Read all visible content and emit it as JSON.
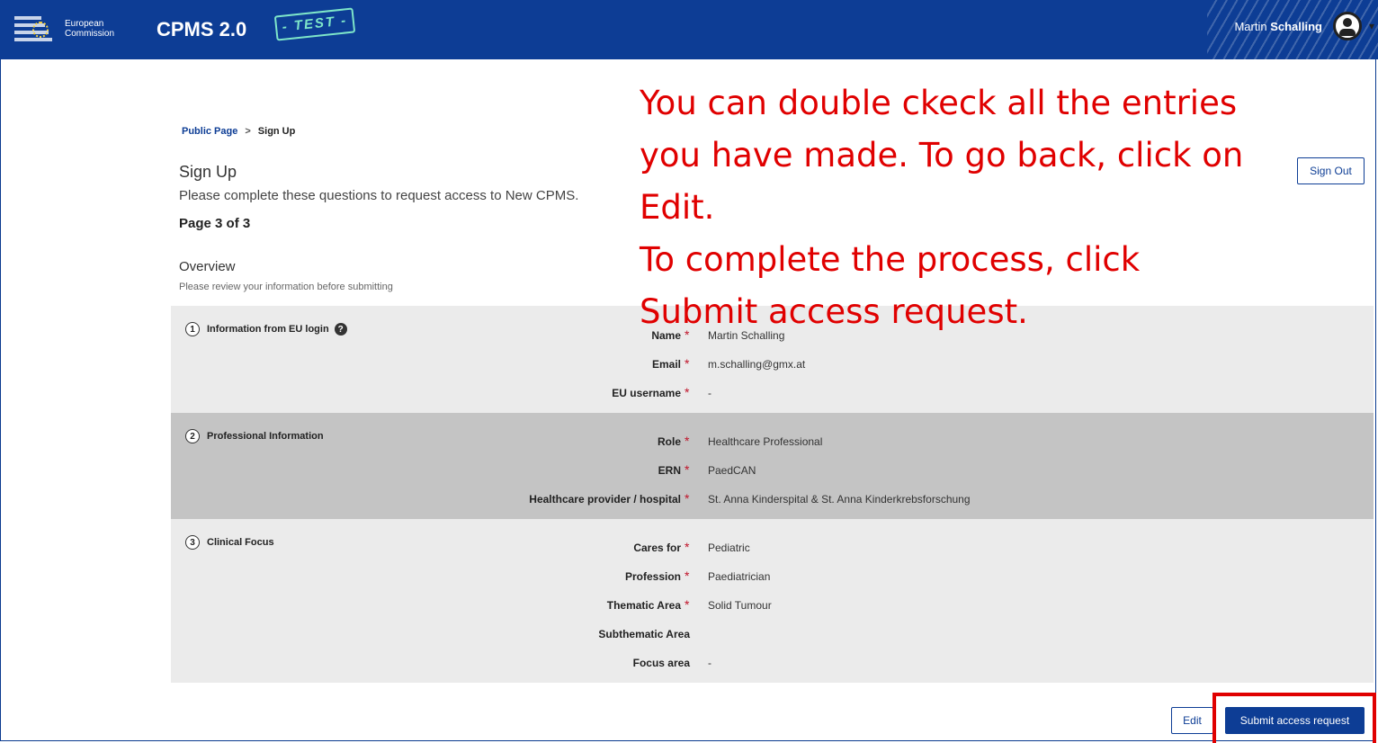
{
  "header": {
    "org_line1": "European",
    "org_line2": "Commission",
    "app_title": "CPMS 2.0",
    "env_badge": "- TEST -",
    "user_first": "Martin",
    "user_last": "Schalling"
  },
  "breadcrumb": {
    "home": "Public Page",
    "separator": ">",
    "current": "Sign Up"
  },
  "page": {
    "title": "Sign Up",
    "intro": "Please complete these questions to request access to New CPMS.",
    "page_count": "Page 3 of 3",
    "overview_title": "Overview",
    "overview_sub": "Please review your information before submitting"
  },
  "buttons": {
    "sign_out": "Sign Out",
    "edit": "Edit",
    "submit": "Submit access request"
  },
  "sections": [
    {
      "num": "1",
      "title": "Information from EU login",
      "fields": [
        {
          "label": "Name",
          "value": "Martin Schalling"
        },
        {
          "label": "Email",
          "value": "m.schalling@gmx.at"
        },
        {
          "label": "EU username",
          "value": "-"
        }
      ]
    },
    {
      "num": "2",
      "title": "Professional Information",
      "fields": [
        {
          "label": "Role",
          "value": "Healthcare Professional"
        },
        {
          "label": "ERN",
          "value": "PaedCAN"
        },
        {
          "label": "Healthcare provider / hospital",
          "value": "St. Anna Kinderspital & St. Anna Kinderkrebsforschung"
        }
      ]
    },
    {
      "num": "3",
      "title": "Clinical Focus",
      "fields": [
        {
          "label": "Cares for",
          "value": "Pediatric"
        },
        {
          "label": "Profession",
          "value": "Paediatrician"
        },
        {
          "label": "Thematic Area",
          "value": "Solid Tumour"
        },
        {
          "label": "Subthematic Area",
          "value": ""
        },
        {
          "label": "Focus area",
          "value": "-"
        }
      ]
    }
  ],
  "required_mark": "*",
  "help_glyph": "?",
  "annotation": {
    "line1": "You can double ckeck all the entries",
    "line2": "you have made. To go back, click on",
    "line3": "Edit.",
    "line4": "To complete the process, click",
    "line5": "Submit access request."
  },
  "colors": {
    "brand": "#0d3d95",
    "annotation": "#e00000",
    "required": "#c0142a"
  }
}
